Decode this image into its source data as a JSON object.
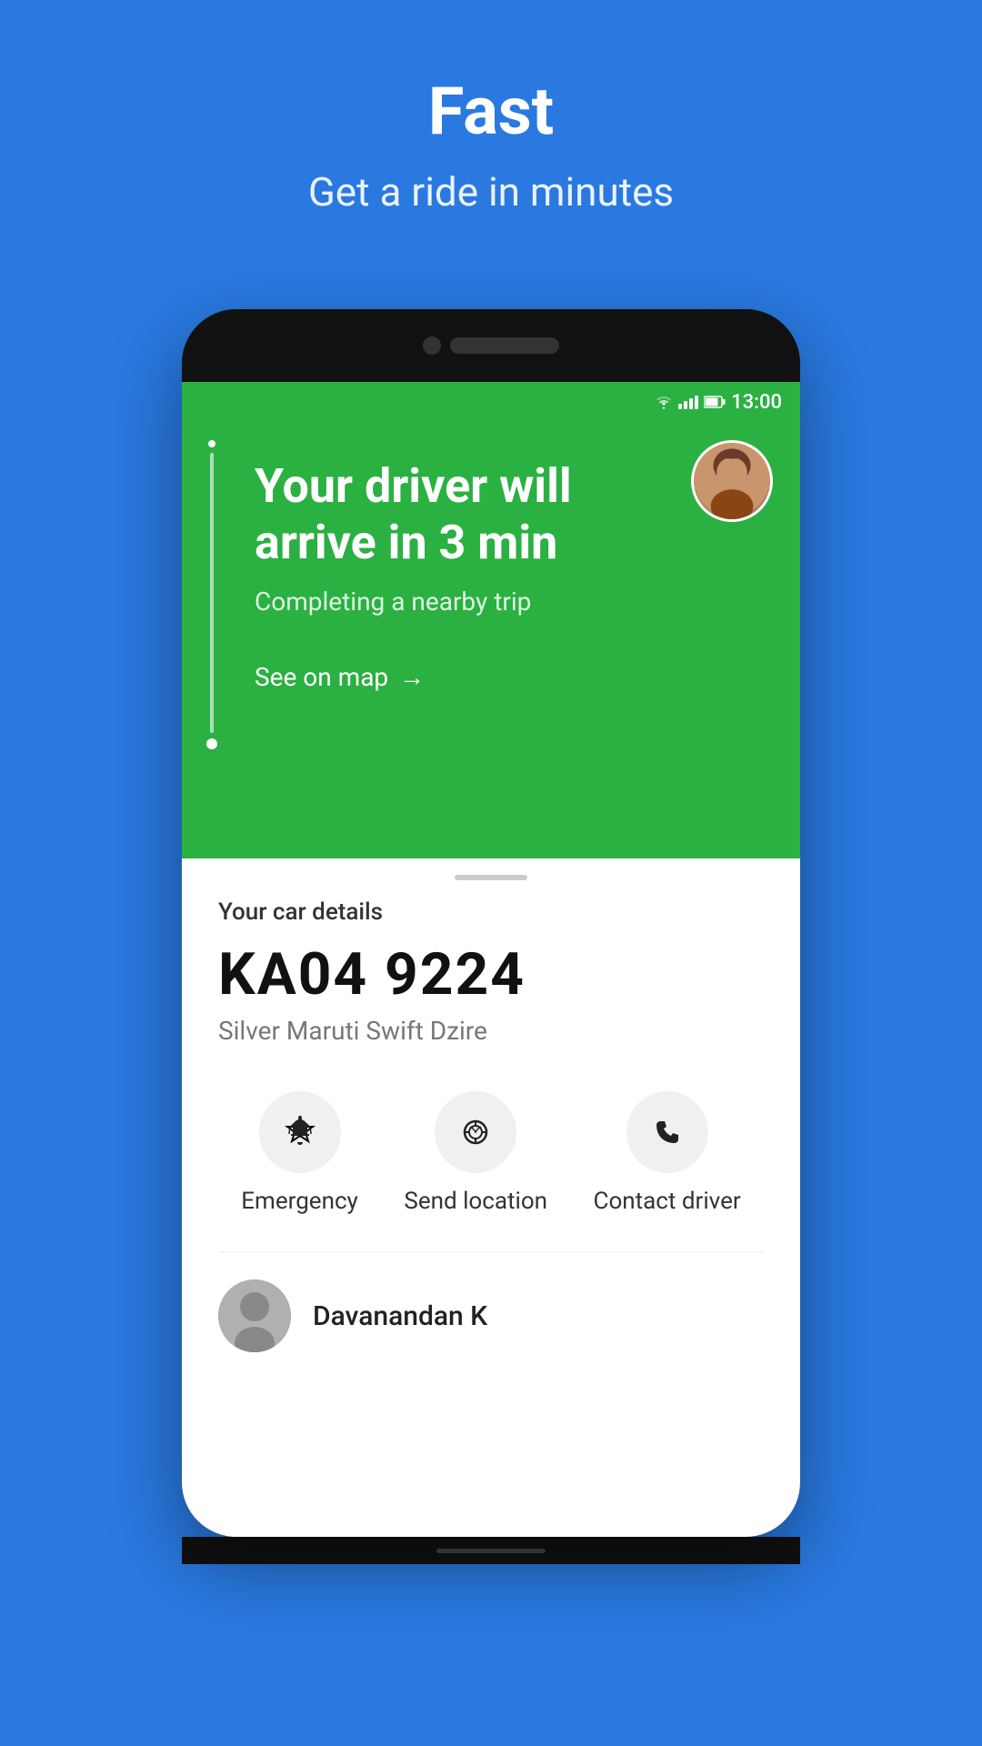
{
  "page": {
    "background_color": "#2979E0",
    "title": "Fast",
    "subtitle": "Get a ride in minutes"
  },
  "status_bar": {
    "time": "13:00",
    "background_color": "#2BB042"
  },
  "green_card": {
    "background_color": "#2BB042",
    "driver_wait_text": "Your driver will arrive in 3 min",
    "driver_wait_line1": "Your driver will",
    "driver_wait_line2": "arrive in 3 min",
    "trip_status": "Completing a nearby trip",
    "see_on_map_label": "See on map",
    "arrow": "→"
  },
  "car_details": {
    "section_label": "Your car details",
    "plate_number": "KA04 9224",
    "car_model": "Silver Maruti Swift Dzire"
  },
  "action_buttons": [
    {
      "id": "emergency",
      "icon": "🔔",
      "label": "Emergency"
    },
    {
      "id": "send-location",
      "icon": "📡",
      "label": "Send location"
    },
    {
      "id": "contact-driver",
      "icon": "📞",
      "label": "Contact driver"
    }
  ],
  "driver": {
    "name": "Davanandan K"
  }
}
